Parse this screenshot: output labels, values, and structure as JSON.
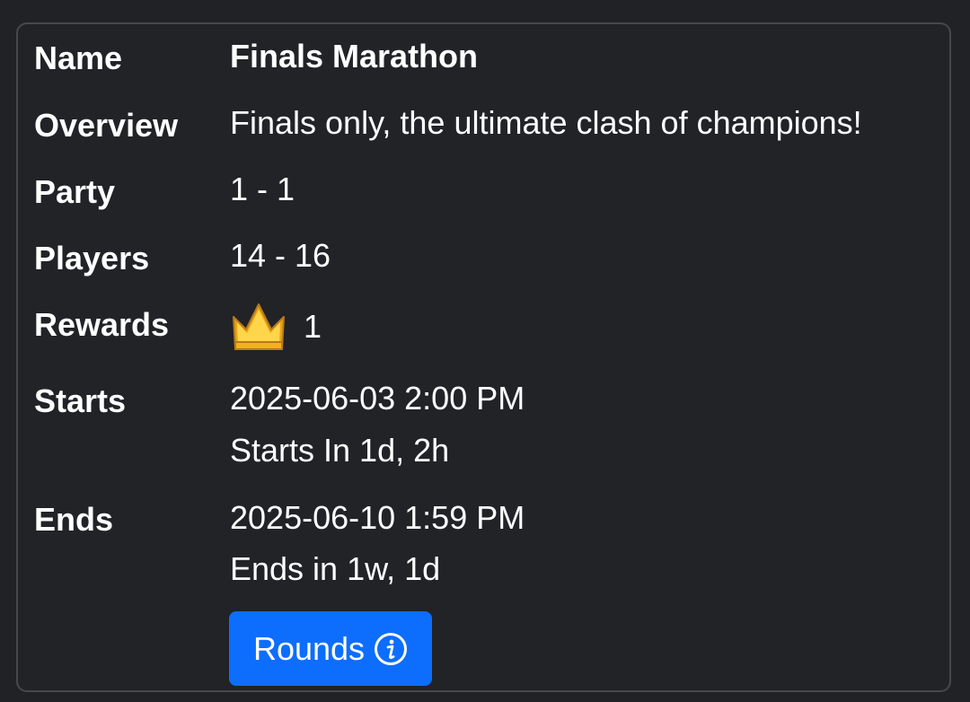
{
  "details": {
    "name_label": "Name",
    "name_value": "Finals Marathon",
    "overview_label": "Overview",
    "overview_value": "Finals only, the ultimate clash of champions!",
    "party_label": "Party",
    "party_value": "1 - 1",
    "players_label": "Players",
    "players_value": "14 - 16",
    "rewards_label": "Rewards",
    "rewards_icon": "crown-icon",
    "rewards_value": "1",
    "starts_label": "Starts",
    "starts_datetime": "2025-06-03 2:00 PM",
    "starts_relative": "Starts In 1d, 2h",
    "ends_label": "Ends",
    "ends_datetime": "2025-06-10 1:59 PM",
    "ends_relative": "Ends in 1w, 1d"
  },
  "rounds_button": {
    "label": "Rounds",
    "icon": "info-icon"
  },
  "colors": {
    "background": "#202226",
    "card_border": "#45484d",
    "button": "#0d6efd",
    "crown": "#f5c518"
  }
}
